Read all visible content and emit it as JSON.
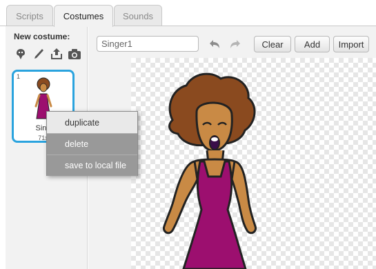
{
  "tabs": [
    {
      "label": "Scripts"
    },
    {
      "label": "Costumes",
      "active": true
    },
    {
      "label": "Sounds"
    }
  ],
  "left_panel": {
    "new_costume_label": "New costume:",
    "tools": [
      "paint-new-costume-icon",
      "brush-icon",
      "upload-icon",
      "camera-icon"
    ],
    "costume_tile": {
      "number": "1",
      "name": "Sing",
      "size": "71x"
    }
  },
  "editor": {
    "name_value": "Singer1",
    "buttons": {
      "clear": "Clear",
      "add": "Add",
      "import": "Import"
    }
  },
  "context_menu": {
    "items": [
      "duplicate",
      "delete",
      "save to local file"
    ]
  },
  "colors": {
    "accent": "#2aa3de",
    "dress": "#9c0f6f",
    "skin": "#c98a45",
    "hair": "#8a4a1f"
  }
}
